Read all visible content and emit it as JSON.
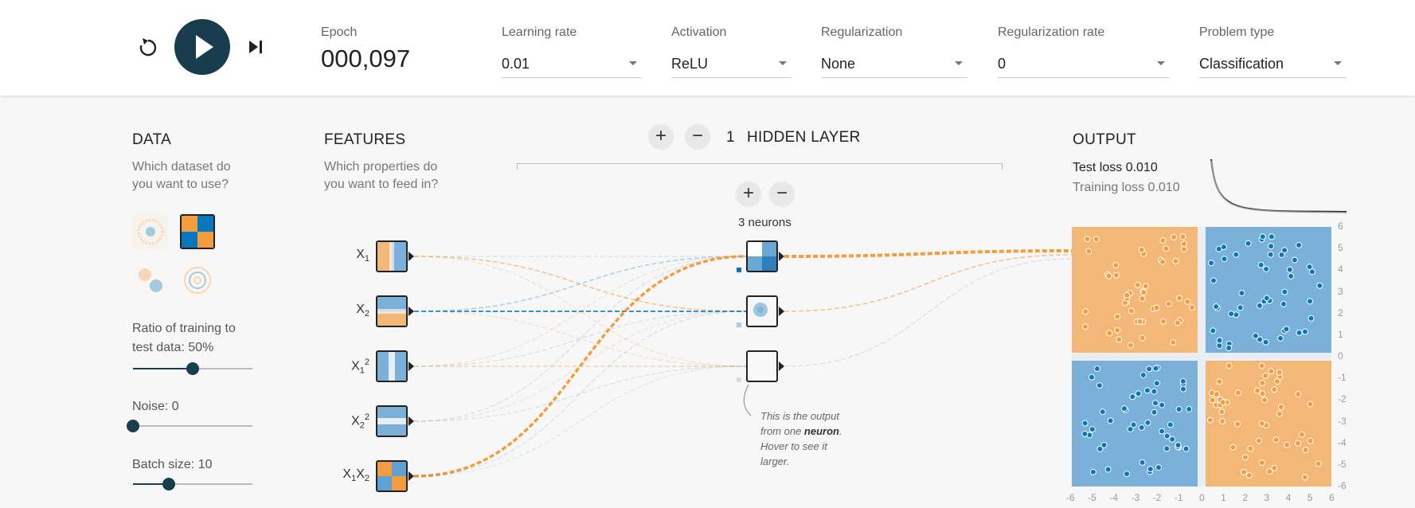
{
  "controls": {
    "reset_icon": "reset-icon",
    "play_icon": "play-icon",
    "step_icon": "step-icon"
  },
  "header": {
    "epoch_label": "Epoch",
    "epoch_value": "000,097",
    "learning_rate_label": "Learning rate",
    "learning_rate_value": "0.01",
    "activation_label": "Activation",
    "activation_value": "ReLU",
    "regularization_label": "Regularization",
    "regularization_value": "None",
    "regularization_rate_label": "Regularization rate",
    "regularization_rate_value": "0",
    "problem_type_label": "Problem type",
    "problem_type_value": "Classification"
  },
  "data_panel": {
    "heading": "DATA",
    "question_line1": "Which dataset do",
    "question_line2": "you want to use?",
    "datasets": [
      "circle",
      "xor",
      "gaussian",
      "spiral"
    ],
    "selected_dataset": "xor",
    "ratio_label_line1": "Ratio of training to",
    "ratio_label_line2": "test data:  50%",
    "ratio_value": 0.5,
    "noise_label": "Noise:  0",
    "noise_value": 0,
    "batch_label": "Batch size:  10",
    "batch_value": 0.3
  },
  "features_panel": {
    "heading": "FEATURES",
    "question_line1": "Which properties do",
    "question_line2": "you want to feed in?",
    "features": [
      {
        "base": "X",
        "sub": "1",
        "sup": "",
        "base2": "",
        "sub2": ""
      },
      {
        "base": "X",
        "sub": "2",
        "sup": "",
        "base2": "",
        "sub2": ""
      },
      {
        "base": "X",
        "sub": "1",
        "sup": "2",
        "base2": "",
        "sub2": ""
      },
      {
        "base": "X",
        "sub": "2",
        "sup": "2",
        "base2": "",
        "sub2": ""
      },
      {
        "base": "X",
        "sub": "1",
        "sup": "",
        "base2": "X",
        "sub2": "2"
      }
    ]
  },
  "hidden_layers": {
    "count": "1",
    "label": "HIDDEN LAYER",
    "add_symbol": "+",
    "remove_symbol": "−",
    "neurons_label": "3 neurons",
    "annotation_pre": "This is the output from one ",
    "annotation_bold": "neuron",
    "annotation_post": ". Hover to see it larger."
  },
  "output_panel": {
    "heading": "OUTPUT",
    "test_loss_label": "Test loss 0.010",
    "training_loss_label": "Training loss 0.010",
    "axis_ticks": [
      "6",
      "5",
      "4",
      "3",
      "2",
      "1",
      "0",
      "-1",
      "-2",
      "-3",
      "-4",
      "-5",
      "-6"
    ],
    "x_ticks": [
      "-6",
      "-5",
      "-4",
      "-3",
      "-2",
      "-1",
      "0",
      "1",
      "2",
      "3",
      "4",
      "5",
      "6"
    ]
  },
  "colors": {
    "orange": "#f59d3e",
    "blue": "#0877bd",
    "dark": "#183d4e",
    "region_orange": "#f3b878",
    "region_blue": "#7bb0d8"
  }
}
